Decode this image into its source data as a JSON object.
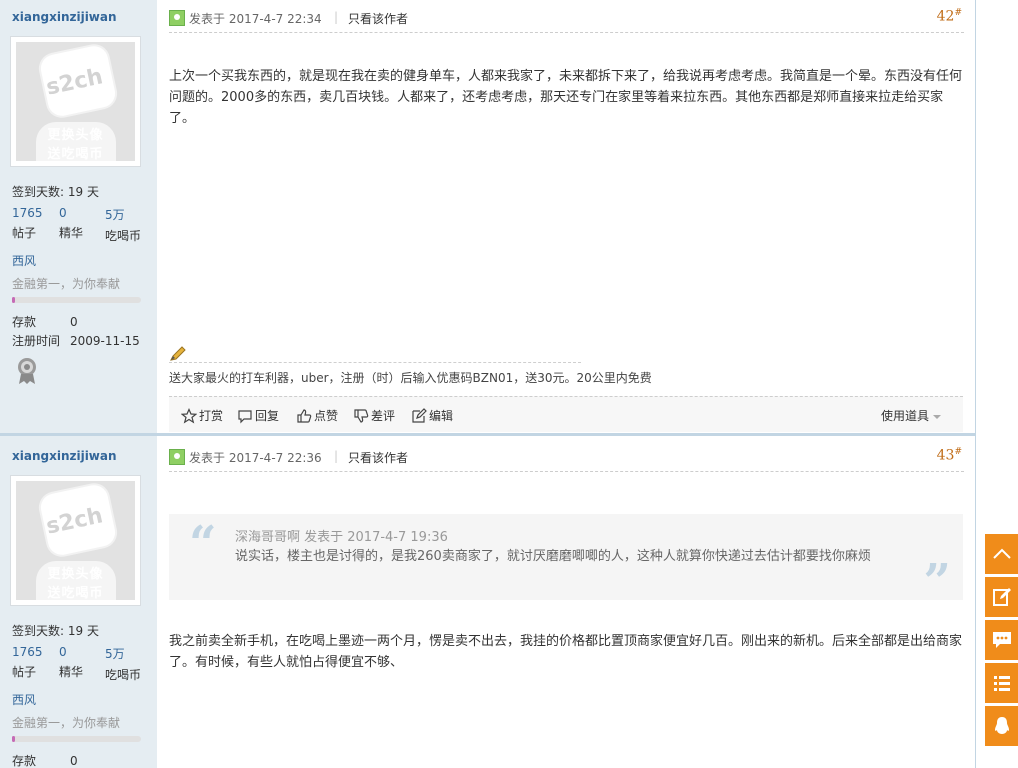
{
  "posts": [
    {
      "username": "xiangxinzijiwan",
      "avatar_text": {
        "line1": "更换头像",
        "line2": "送吃喝币"
      },
      "checkin": "签到天数: 19 天",
      "stats": [
        {
          "value": "1765",
          "label": "帖子"
        },
        {
          "value": "0",
          "label": "精华"
        },
        {
          "value": "5万",
          "label": "吃喝币"
        }
      ],
      "group": "西风",
      "motto": "金融第一，为你奉献",
      "level_progress": 0.02,
      "deposit_label": "存款",
      "deposit_value": "0",
      "regdate_label": "注册时间",
      "regdate_value": "2009-11-15",
      "posted_at": "发表于 2017-4-7 22:34",
      "author_only": "只看该作者",
      "floor": "42",
      "floor_mark": "#",
      "content": "上次一个买我东西的，就是现在我在卖的健身单车，人都来我家了，未来都拆下来了，给我说再考虑考虑。我简直是一个晕。东西没有任何问题的。2000多的东西，卖几百块钱。人都来了，还考虑考虑，那天还专门在家里等着来拉东西。其他东西都是郑师直接来拉走给买家了。",
      "signature": "送大家最火的打车利器，uber，注册（时）后输入优惠码BZN01，送30元。20公里内免费",
      "actions": {
        "reward": "打赏",
        "reply": "回复",
        "like": "点赞",
        "dislike": "差评",
        "edit": "编辑",
        "tools": "使用道具"
      }
    },
    {
      "username": "xiangxinzijiwan",
      "avatar_text": {
        "line1": "更换头像",
        "line2": "送吃喝币"
      },
      "checkin": "签到天数: 19 天",
      "stats": [
        {
          "value": "1765",
          "label": "帖子"
        },
        {
          "value": "0",
          "label": "精华"
        },
        {
          "value": "5万",
          "label": "吃喝币"
        }
      ],
      "group": "西风",
      "motto": "金融第一，为你奉献",
      "level_progress": 0.02,
      "deposit_label": "存款",
      "deposit_value": "0",
      "posted_at": "发表于 2017-4-7 22:36",
      "author_only": "只看该作者",
      "floor": "43",
      "floor_mark": "#",
      "quote": {
        "meta": "深海哥哥啊 发表于 2017-4-7 19:36",
        "text": "说实话，楼主也是讨得的，是我260卖商家了，就讨厌磨磨唧唧的人，这种人就算你快递过去估计都要找你麻烦"
      },
      "content": "我之前卖全新手机，在吃喝上墨迹一两个月，愣是卖不出去，我挂的价格都比置顶商家便宜好几百。刚出来的新机。后来全部都是出给商家了。有时候，有些人就怕占得便宜不够、"
    }
  ],
  "float_bar": [
    "back-to-top",
    "new-post",
    "reply",
    "list",
    "qq-service"
  ],
  "colors": {
    "accent": "#336699",
    "float": "#f08c1a",
    "floor": "#c06c17",
    "sidebar_bg": "#e5edf2"
  }
}
